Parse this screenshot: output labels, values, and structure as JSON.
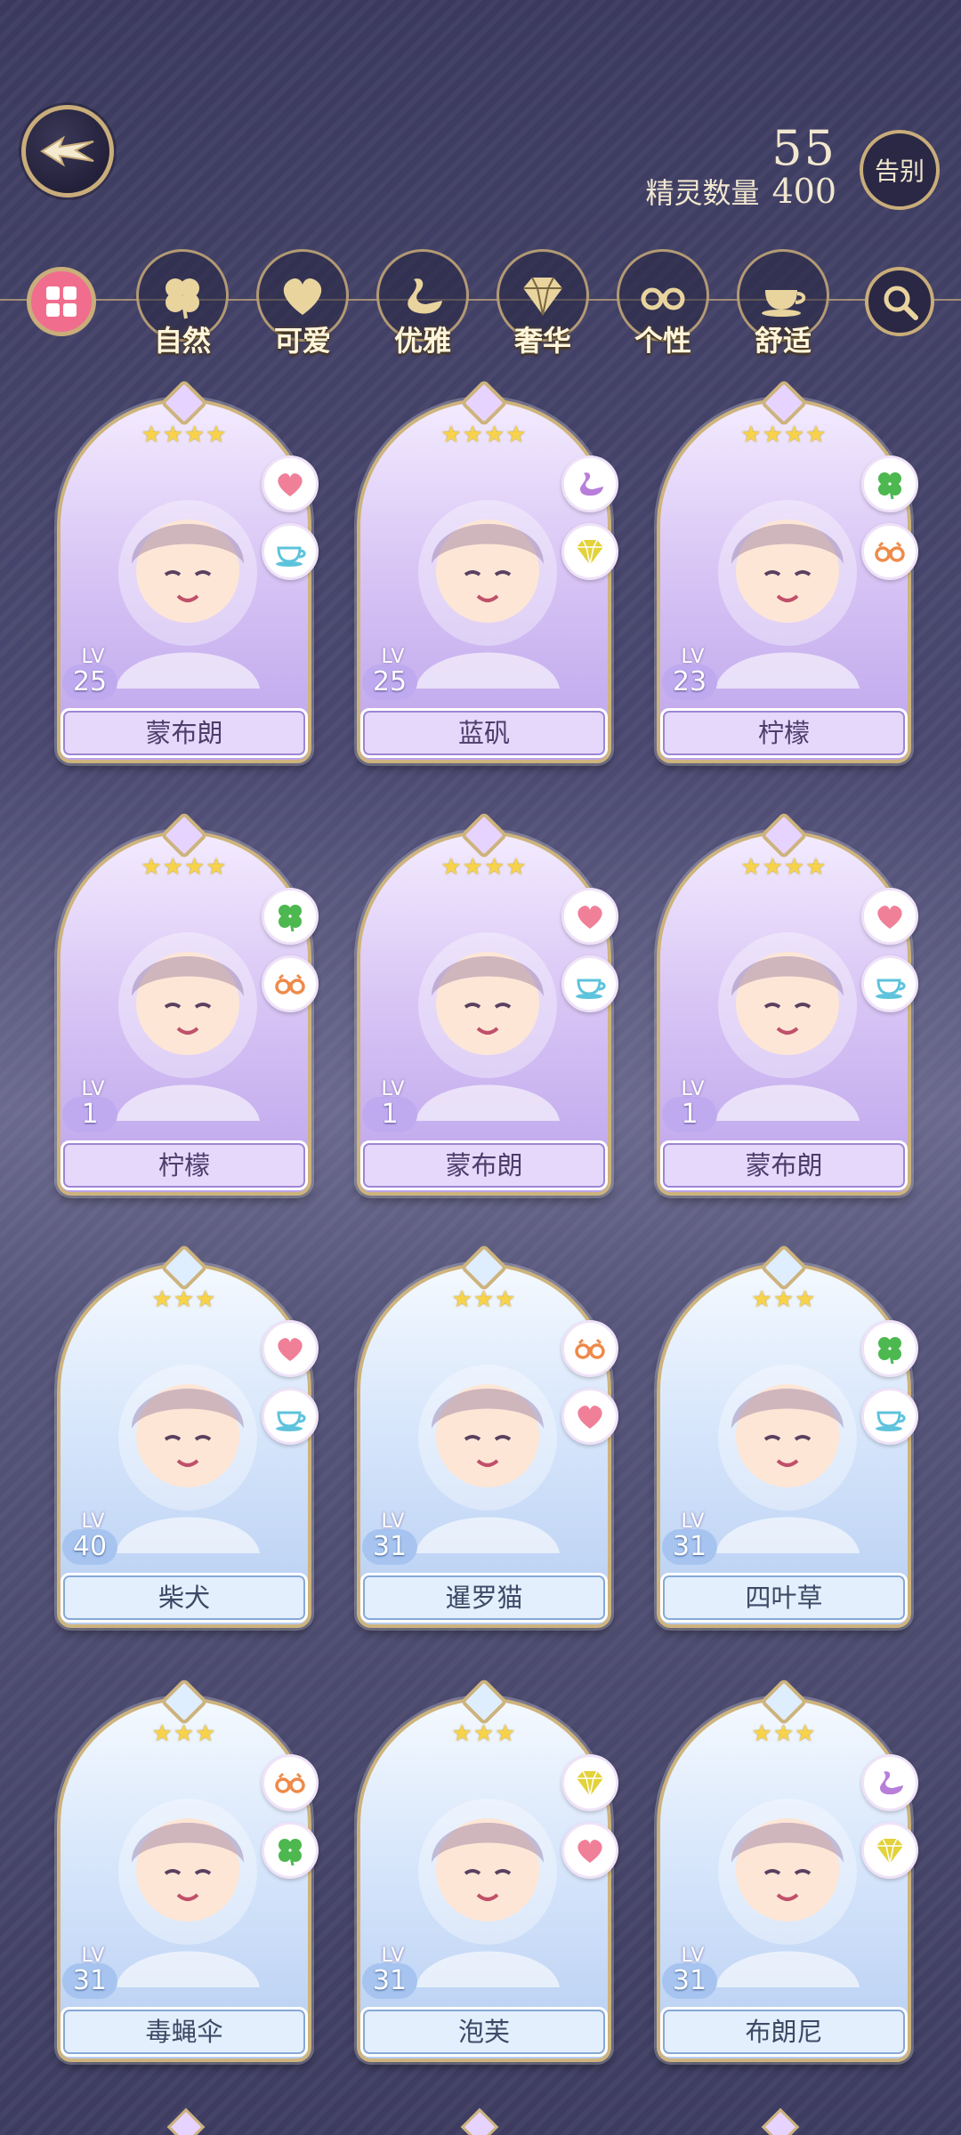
{
  "header": {
    "back_icon": "winged-back-arrow-icon",
    "spirit_count": "55",
    "spirit_label": "精灵数量",
    "spirit_max": "400",
    "farewell_label": "告别"
  },
  "filters": {
    "all_icon": "grid-icon",
    "search_icon": "search-icon",
    "items": [
      {
        "label": "自然",
        "icon": "clover-icon"
      },
      {
        "label": "可爱",
        "icon": "heart-icon"
      },
      {
        "label": "优雅",
        "icon": "swan-icon"
      },
      {
        "label": "奢华",
        "icon": "diamond-icon"
      },
      {
        "label": "个性",
        "icon": "glasses-icon"
      },
      {
        "label": "舒适",
        "icon": "teacup-icon"
      }
    ]
  },
  "lv_label": "LV",
  "cards": [
    {
      "name": "蒙布朗",
      "level": "25",
      "stars": "★★★★",
      "tags": [
        "heart-icon",
        "teacup-icon"
      ]
    },
    {
      "name": "蓝矾",
      "level": "25",
      "stars": "★★★★",
      "tags": [
        "swan-icon",
        "diamond-icon"
      ]
    },
    {
      "name": "柠檬",
      "level": "23",
      "stars": "★★★★",
      "tags": [
        "clover-icon",
        "glasses-icon"
      ]
    },
    {
      "name": "柠檬",
      "level": "1",
      "stars": "★★★★",
      "tags": [
        "clover-icon",
        "glasses-icon"
      ]
    },
    {
      "name": "蒙布朗",
      "level": "1",
      "stars": "★★★★",
      "tags": [
        "heart-icon",
        "teacup-icon"
      ]
    },
    {
      "name": "蒙布朗",
      "level": "1",
      "stars": "★★★★",
      "tags": [
        "heart-icon",
        "teacup-icon"
      ]
    },
    {
      "name": "柴犬",
      "level": "40",
      "stars": "★★★",
      "tags": [
        "heart-icon",
        "teacup-icon"
      ]
    },
    {
      "name": "暹罗猫",
      "level": "31",
      "stars": "★★★",
      "tags": [
        "glasses-icon",
        "heart-icon"
      ]
    },
    {
      "name": "四叶草",
      "level": "31",
      "stars": "★★★",
      "tags": [
        "clover-icon",
        "teacup-icon"
      ]
    },
    {
      "name": "毒蝇伞",
      "level": "31",
      "stars": "★★★",
      "tags": [
        "glasses-icon",
        "clover-icon"
      ]
    },
    {
      "name": "泡芙",
      "level": "31",
      "stars": "★★★",
      "tags": [
        "diamond-icon",
        "heart-icon"
      ]
    },
    {
      "name": "布朗尼",
      "level": "31",
      "stars": "★★★",
      "tags": [
        "swan-icon",
        "diamond-icon"
      ]
    }
  ],
  "colors": {
    "heart": "#f07f98",
    "teacup": "#5ec3dc",
    "swan": "#b77fd9",
    "diamond": "#e3d23a",
    "clover": "#4cb84f",
    "glasses": "#ef8a4a",
    "gold": "#c9ad7a"
  }
}
